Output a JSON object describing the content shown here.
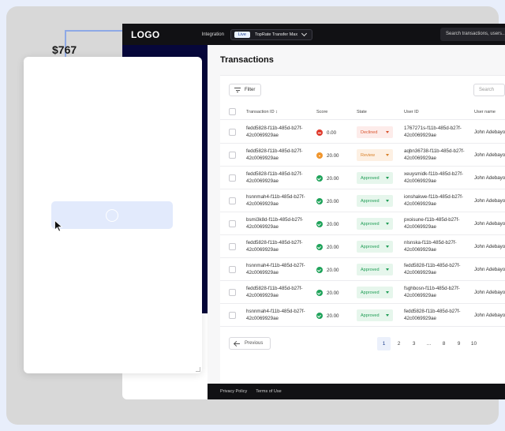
{
  "overlay": {
    "amount": "$767"
  },
  "topbar": {
    "logo": "LOGO",
    "integration_label": "Integration",
    "live_badge": "Live",
    "environment_name": "TopRate Transfer Max",
    "search_placeholder": "Search transactions, users..."
  },
  "page": {
    "title": "Transactions",
    "filter_label": "Filter",
    "search_placeholder": "Search"
  },
  "table": {
    "columns": [
      "Transaction ID ↕",
      "Score",
      "State",
      "User ID",
      "User name"
    ],
    "rows": [
      {
        "id": "fedd5828-f11b-485d-b27f-42c0069929ae",
        "score": "0.00",
        "state": "Declined",
        "user_id": "1767271s-f11b-485d-b27f-42c0069929ae",
        "user_name": "John Adebayo"
      },
      {
        "id": "fedd5828-f11b-485d-b27f-42c0069929ae",
        "score": "20.00",
        "state": "Review",
        "user_id": "aqbn36738-f11b-485d-b27f-42c0069929ae",
        "user_name": "John Adebayo"
      },
      {
        "id": "fedd5828-f11b-485d-b27f-42c0069929ae",
        "score": "20.00",
        "state": "Approved",
        "user_id": "xeuysmidk-f11b-485d-b27f-42c0069929ae",
        "user_name": "John Adebayo"
      },
      {
        "id": "hsnnmah4-f11b-485d-b27f-42c0069929ae",
        "score": "20.00",
        "state": "Approved",
        "user_id": "ionshakwe-f11b-485d-b27f-42c0069929ae",
        "user_name": "John Adebayo"
      },
      {
        "id": "bsmi3k8d-f11b-485d-b27f-42c0069929ae",
        "score": "20.00",
        "state": "Approved",
        "user_id": "pxoisune-f11b-485d-b27f-42c0069929ae",
        "user_name": "John Adebayo"
      },
      {
        "id": "fedd5828-f11b-485d-b27f-42c0069929ae",
        "score": "20.00",
        "state": "Approved",
        "user_id": "nlsnska-f11b-485d-b27f-42c0069929ae",
        "user_name": "John Adebayo"
      },
      {
        "id": "hsnnmah4-f11b-485d-b27f-42c0069929ae",
        "score": "20.00",
        "state": "Approved",
        "user_id": "fedd5828-f11b-485d-b27f-42c0069929ae",
        "user_name": "John Adebayo"
      },
      {
        "id": "fedd5828-f11b-485d-b27f-42c0069929ae",
        "score": "20.00",
        "state": "Approved",
        "user_id": "fsghbosn-f11b-485d-b27f-42c0069929ae",
        "user_name": "John Adebayo"
      },
      {
        "id": "hsnnmah4-f11b-485d-b27f-42c0069929ae",
        "score": "20.00",
        "state": "Approved",
        "user_id": "fedd5828-f11b-485d-b27f-42c0069929ae",
        "user_name": "John Adebayo"
      }
    ]
  },
  "pagination": {
    "previous_label": "Previous",
    "pages": [
      "1",
      "2",
      "3",
      "...",
      "8",
      "9",
      "10"
    ],
    "active_page": "1"
  },
  "footer": {
    "privacy": "Privacy Policy",
    "terms": "Terms of Use"
  },
  "colors": {
    "declined_bg": "#fdecea",
    "declined_fg": "#d9552f",
    "declined_dot": "#e03d2f",
    "review_bg": "#fdf0e3",
    "review_fg": "#d9822b",
    "review_dot": "#f0962d",
    "approved_bg": "#e6f6ec",
    "approved_fg": "#1f9d55",
    "approved_dot": "#1fa35a"
  }
}
